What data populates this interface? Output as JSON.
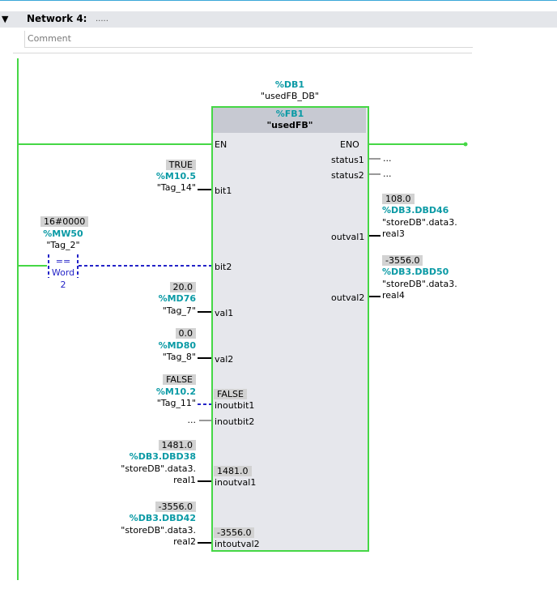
{
  "network": {
    "title": "Network 4:",
    "subtitle": ".....",
    "comment": "Comment"
  },
  "block": {
    "instance_address": "%DB1",
    "instance_name": "\"usedFB_DB\"",
    "fb_address": "%FB1",
    "fb_name": "\"usedFB\"",
    "en": "EN",
    "eno": "ENO"
  },
  "inputs": {
    "bit1": {
      "value": "TRUE",
      "address": "%M10.5",
      "tag": "\"Tag_14\"",
      "pin": "bit1"
    },
    "bit2": {
      "pin": "bit2"
    },
    "val1": {
      "value": "20.0",
      "address": "%MD76",
      "tag": "\"Tag_7\"",
      "pin": "val1"
    },
    "val2": {
      "value": "0.0",
      "address": "%MD80",
      "tag": "\"Tag_8\"",
      "pin": "val2"
    },
    "inoutbit1": {
      "value": "FALSE",
      "address": "%M10.2",
      "tag": "\"Tag_11\"",
      "inner_value": "FALSE",
      "pin": "inoutbit1"
    },
    "inoutbit2": {
      "dots": "...",
      "pin": "inoutbit2"
    },
    "inoutval1": {
      "value": "1481.0",
      "address": "%DB3.DBD38",
      "tag_line1": "\"storeDB\".data3.",
      "tag_line2": "real1",
      "inner_value": "1481.0",
      "pin": "inoutval1"
    },
    "intoutval2": {
      "value": "-3556.0",
      "address": "%DB3.DBD42",
      "tag_line1": "\"storeDB\".data3.",
      "tag_line2": "real2",
      "inner_value": "-3556.0",
      "pin": "intoutval2"
    }
  },
  "compare": {
    "value": "16#0000",
    "address": "%MW50",
    "tag": "\"Tag_2\"",
    "op": "==",
    "type": "Word",
    "param": "2"
  },
  "outputs": {
    "status1": {
      "pin": "status1",
      "dots": "..."
    },
    "status2": {
      "pin": "status2",
      "dots": "..."
    },
    "outval1": {
      "pin": "outval1",
      "value": "108.0",
      "address": "%DB3.DBD46",
      "tag_line1": "\"storeDB\".data3.",
      "tag_line2": "real3"
    },
    "outval2": {
      "pin": "outval2",
      "value": "-3556.0",
      "address": "%DB3.DBD50",
      "tag_line1": "\"storeDB\".data3.",
      "tag_line2": "real4"
    }
  },
  "colors": {
    "power": "#45d745",
    "address": "#0a9aa5",
    "dashed": "#2424c8"
  }
}
